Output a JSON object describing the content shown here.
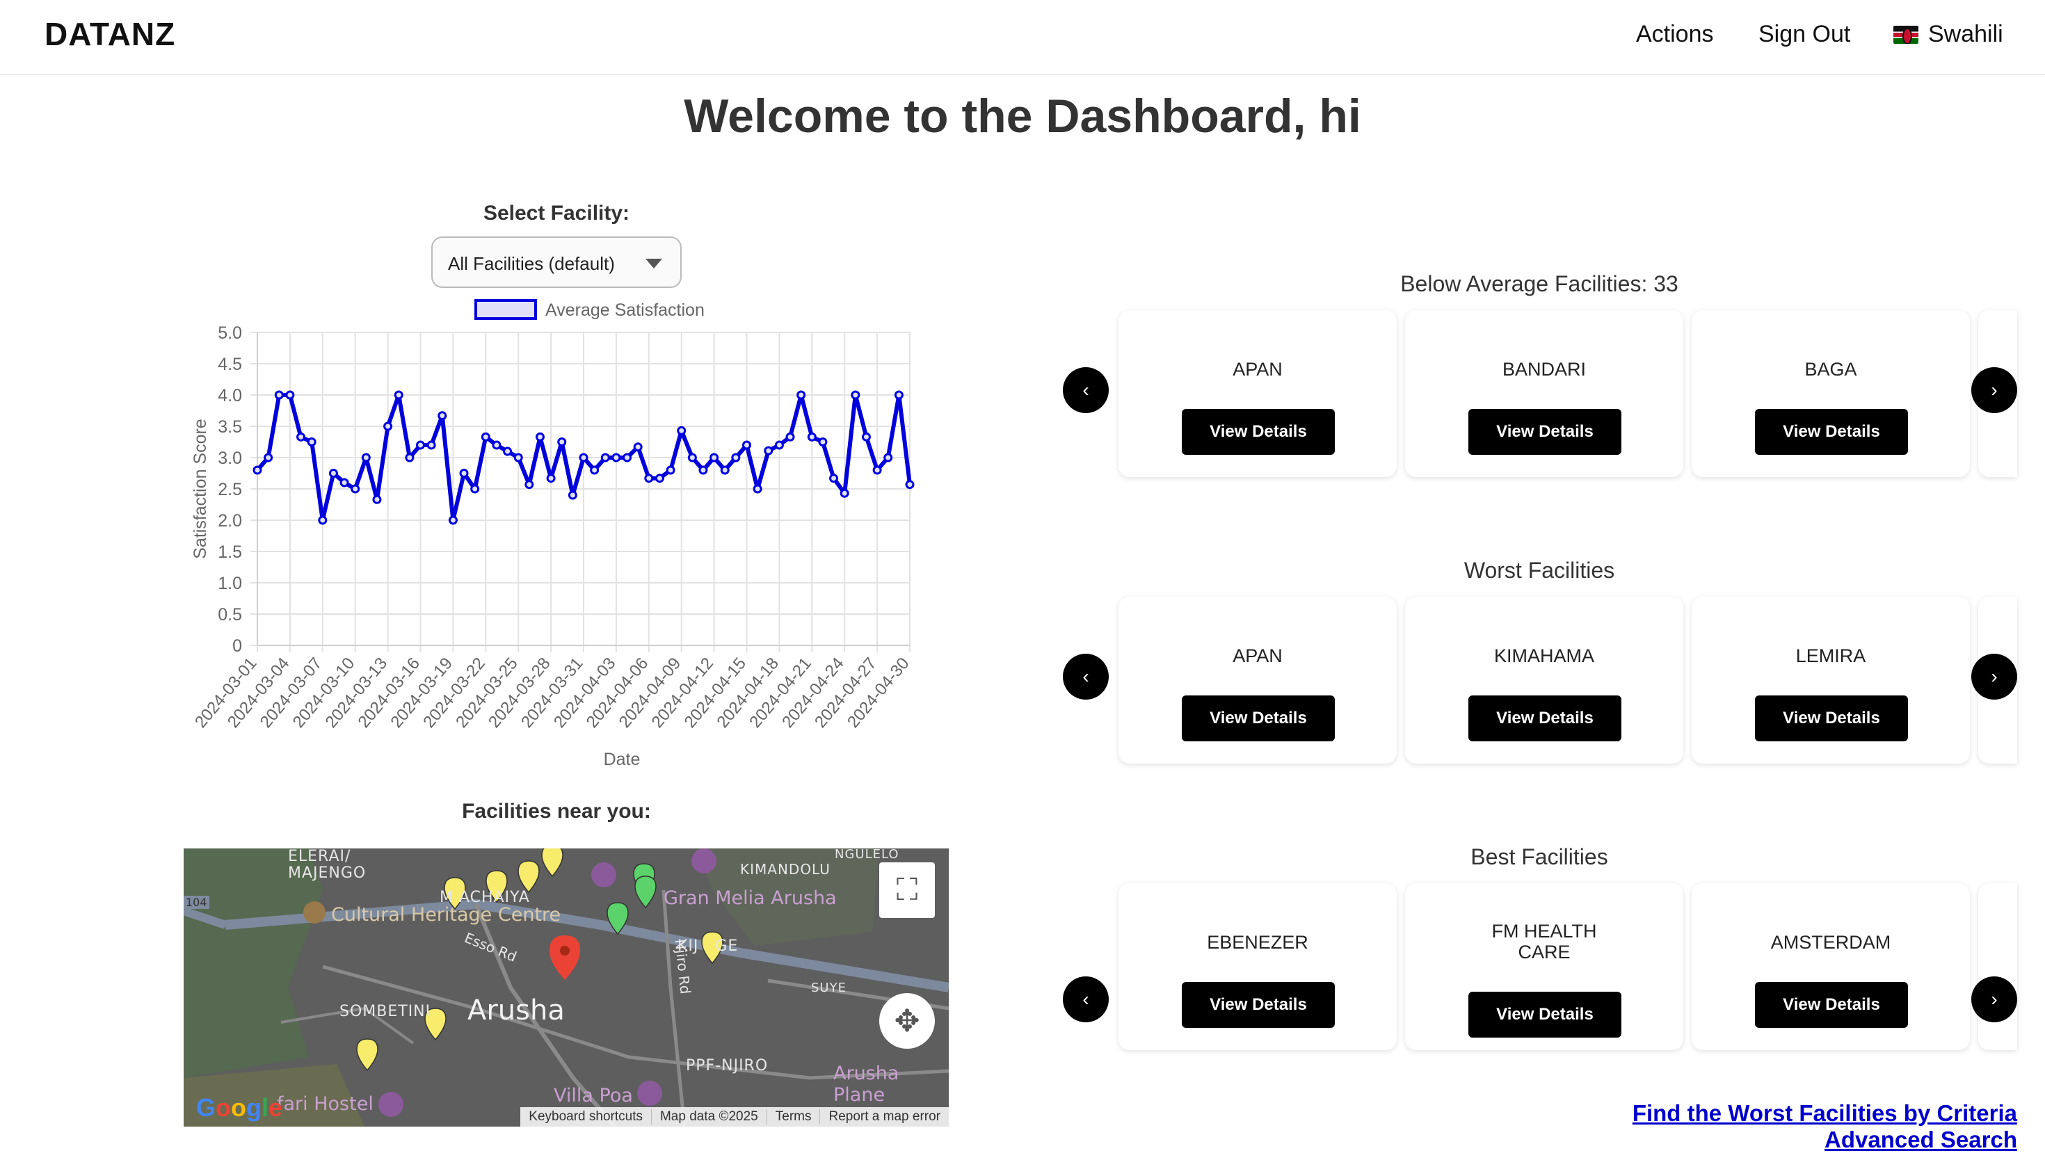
{
  "nav": {
    "logo": "DATANZ",
    "actions": "Actions",
    "sign_out": "Sign Out",
    "language": "Swahili",
    "flag_icon": "kenya-flag-icon"
  },
  "page_title": "Welcome to the Dashboard, hi",
  "facility_select": {
    "label": "Select Facility:",
    "value": "All Facilities (default)"
  },
  "chart_data": {
    "type": "line",
    "legend": [
      "Average Satisfaction"
    ],
    "legend_position": "top",
    "xlabel": "Date",
    "ylabel": "Satisfaction Score",
    "ylim": [
      0,
      5
    ],
    "yticks": [
      "5.0",
      "4.5",
      "4.0",
      "3.5",
      "3.0",
      "2.5",
      "2.0",
      "1.5",
      "1.0",
      "0.5",
      "0"
    ],
    "xtick_labels": [
      "2024-03-01",
      "2024-03-04",
      "2024-03-07",
      "2024-03-10",
      "2024-03-13",
      "2024-03-16",
      "2024-03-19",
      "2024-03-22",
      "2024-03-25",
      "2024-03-28",
      "2024-03-31",
      "2024-04-03",
      "2024-04-06",
      "2024-04-09",
      "2024-04-12",
      "2024-04-15",
      "2024-04-18",
      "2024-04-21",
      "2024-04-24",
      "2024-04-27",
      "2024-04-30"
    ],
    "grid": true,
    "color": "#0000dd",
    "series": [
      {
        "name": "Average Satisfaction",
        "x": [
          "2024-03-01",
          "2024-03-02",
          "2024-03-03",
          "2024-03-04",
          "2024-03-05",
          "2024-03-06",
          "2024-03-07",
          "2024-03-08",
          "2024-03-09",
          "2024-03-10",
          "2024-03-11",
          "2024-03-12",
          "2024-03-13",
          "2024-03-14",
          "2024-03-15",
          "2024-03-16",
          "2024-03-17",
          "2024-03-18",
          "2024-03-19",
          "2024-03-20",
          "2024-03-21",
          "2024-03-22",
          "2024-03-23",
          "2024-03-24",
          "2024-03-25",
          "2024-03-26",
          "2024-03-27",
          "2024-03-28",
          "2024-03-29",
          "2024-03-30",
          "2024-03-31",
          "2024-04-01",
          "2024-04-02",
          "2024-04-03",
          "2024-04-04",
          "2024-04-05",
          "2024-04-06",
          "2024-04-07",
          "2024-04-08",
          "2024-04-09",
          "2024-04-10",
          "2024-04-11",
          "2024-04-12",
          "2024-04-13",
          "2024-04-14",
          "2024-04-15",
          "2024-04-16",
          "2024-04-17",
          "2024-04-18",
          "2024-04-19",
          "2024-04-20",
          "2024-04-21",
          "2024-04-22",
          "2024-04-23",
          "2024-04-24",
          "2024-04-25",
          "2024-04-26",
          "2024-04-27",
          "2024-04-28",
          "2024-04-29",
          "2024-04-30"
        ],
        "values": [
          2.8,
          3.0,
          4.0,
          4.0,
          3.33,
          3.25,
          2.0,
          2.75,
          2.6,
          2.5,
          3.0,
          2.33,
          3.5,
          4.0,
          3.0,
          3.2,
          3.2,
          3.67,
          2.0,
          2.75,
          2.5,
          3.33,
          3.2,
          3.1,
          3.0,
          2.57,
          3.33,
          2.67,
          3.25,
          2.4,
          3.0,
          2.8,
          3.0,
          3.0,
          3.0,
          3.17,
          2.67,
          2.67,
          2.8,
          3.43,
          3.0,
          2.8,
          3.0,
          2.8,
          3.0,
          3.2,
          2.5,
          3.11,
          3.2,
          3.33,
          4.0,
          3.33,
          3.25,
          2.67,
          2.43,
          4.0,
          3.33,
          2.8,
          3.0,
          4.0,
          2.57
        ]
      }
    ]
  },
  "map": {
    "label": "Facilities near you:",
    "labels": {
      "elerai": "ELERAI/\nMAJENGO",
      "kimandolu": "KIMANDOLU",
      "ngulelo": "NGULELO",
      "gran_melia": "Gran Melia Arusha",
      "cultural": "Cultural Heritage Centre",
      "esso": "Esso Rd",
      "njiro": "Njiro Rd",
      "kijenge": "KIJ   GE",
      "suye": "SUYE",
      "sombetini": "SOMBETINI",
      "arusha": "Arusha",
      "ppf": "PPF-NJIRO",
      "villa": "Villa Poa",
      "arusha_plane": "Arusha Plane",
      "safari_hostel": "fari Hostel",
      "road_104": "104",
      "machaiya": "M  ACHAIYA"
    },
    "footer": {
      "keyboard": "Keyboard shortcuts",
      "map_data": "Map data ©2025",
      "terms": "Terms",
      "report": "Report a map error"
    },
    "google": [
      "G",
      "o",
      "o",
      "g",
      "l",
      "e"
    ]
  },
  "sections": [
    {
      "title": "Below Average Facilities: 33",
      "cards": [
        {
          "name": "APAN",
          "button": "View Details"
        },
        {
          "name": "BANDARI",
          "button": "View Details"
        },
        {
          "name": "BAGA",
          "button": "View Details"
        }
      ]
    },
    {
      "title": "Worst Facilities",
      "cards": [
        {
          "name": "APAN",
          "button": "View Details"
        },
        {
          "name": "KIMAHAMA",
          "button": "View Details"
        },
        {
          "name": "LEMIRA",
          "button": "View Details"
        }
      ]
    },
    {
      "title": "Best Facilities",
      "cards": [
        {
          "name": "EBENEZER",
          "button": "View Details"
        },
        {
          "name": "FM HEALTH CARE",
          "button": "View Details"
        },
        {
          "name": "AMSTERDAM",
          "button": "View Details"
        }
      ]
    }
  ],
  "carousel": {
    "prev": "‹",
    "next": "›"
  },
  "links": {
    "worst_by_criteria": "Find the Worst Facilities by Criteria",
    "advanced_search": "Advanced Search"
  }
}
